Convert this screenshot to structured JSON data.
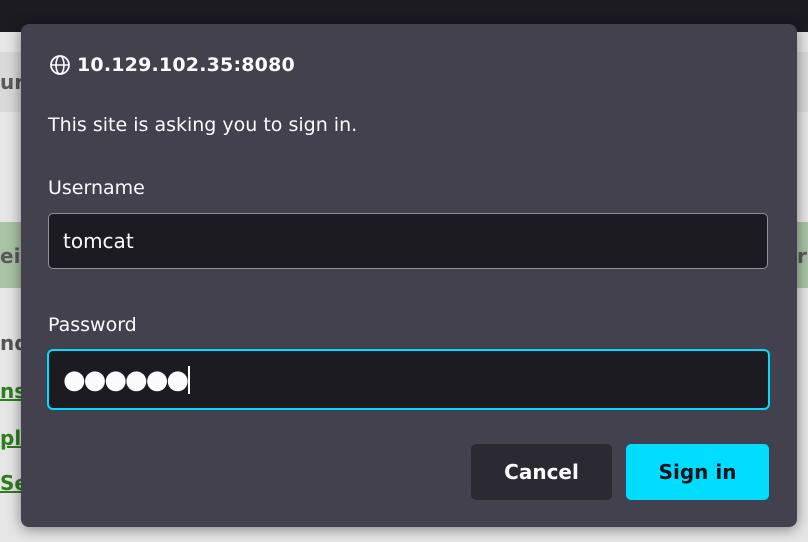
{
  "background_page": {
    "fragments": [
      "ura",
      "ei",
      "r",
      "nd",
      "ns",
      "pl",
      "Se"
    ]
  },
  "dialog": {
    "origin": "10.129.102.35:8080",
    "origin_icon": "globe-icon",
    "message": "This site is asking you to sign in.",
    "username_label": "Username",
    "username_value": "tomcat",
    "password_label": "Password",
    "password_mask": "●●●●●●",
    "cancel_label": "Cancel",
    "signin_label": "Sign in"
  },
  "colors": {
    "dialog_bg": "#42414d",
    "input_bg": "#1c1b22",
    "focus_accent": "#00ddff",
    "cancel_bg": "#2b2a33"
  }
}
